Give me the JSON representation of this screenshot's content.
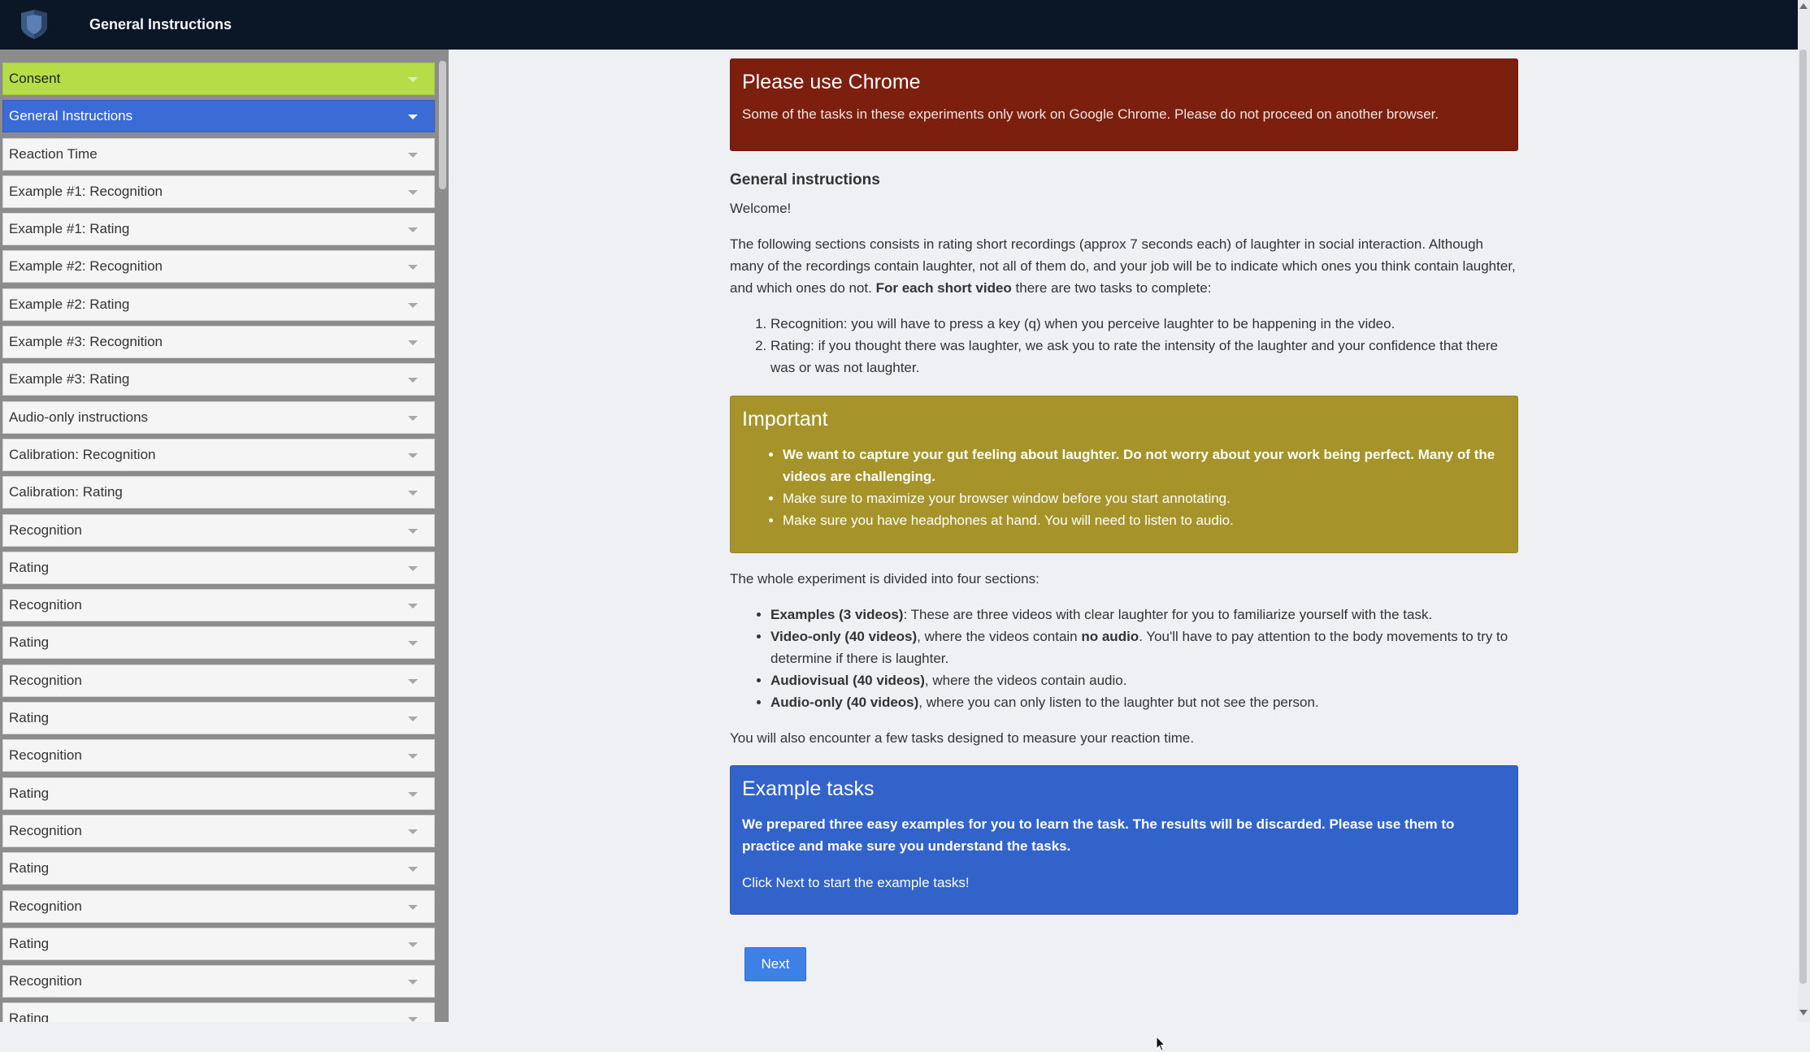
{
  "header": {
    "title": "General Instructions",
    "logo_icon": "shield-icon"
  },
  "sidebar": {
    "items": [
      {
        "label": "Consent"
      },
      {
        "label": "General Instructions"
      },
      {
        "label": "Reaction Time"
      },
      {
        "label": "Example #1: Recognition"
      },
      {
        "label": "Example #1: Rating"
      },
      {
        "label": "Example #2: Recognition"
      },
      {
        "label": "Example #2: Rating"
      },
      {
        "label": "Example #3: Recognition"
      },
      {
        "label": "Example #3: Rating"
      },
      {
        "label": "Audio-only instructions"
      },
      {
        "label": "Calibration: Recognition"
      },
      {
        "label": "Calibration: Rating"
      },
      {
        "label": "Recognition"
      },
      {
        "label": "Rating"
      },
      {
        "label": "Recognition"
      },
      {
        "label": "Rating"
      },
      {
        "label": "Recognition"
      },
      {
        "label": "Rating"
      },
      {
        "label": "Recognition"
      },
      {
        "label": "Rating"
      },
      {
        "label": "Recognition"
      },
      {
        "label": "Rating"
      },
      {
        "label": "Recognition"
      },
      {
        "label": "Rating"
      },
      {
        "label": "Recognition"
      },
      {
        "label": "Rating"
      }
    ]
  },
  "chrome_alert": {
    "title": "Please use Chrome",
    "text": "Some of the tasks in these experiments only work on Google Chrome. Please do not proceed on another browser."
  },
  "instructions": {
    "heading": "General instructions",
    "welcome": "Welcome!",
    "intro": "The following sections consists in rating short recordings (approx 7 seconds each) of laughter in social interaction. Although many of the recordings contain laughter, not all of them do, and your job will be to indicate which ones you think contain laughter, and which ones do not.",
    "intro_bold": "For each short video",
    "intro_tail": " there are two tasks to complete:",
    "tasks": [
      "Recognition: you will have to press a key (q) when you perceive laughter to be happening in the video.",
      "Rating: if you thought there was laughter, we ask you to rate the intensity of the laughter and your confidence that there was or was not laughter."
    ]
  },
  "important": {
    "title": "Important",
    "items": [
      "We want to capture your gut feeling about laughter. Do not worry about your work being perfect. Many of the videos are challenging.",
      "Make sure to maximize your browser window before you start annotating.",
      "Make sure you have headphones at hand. You will need to listen to audio."
    ]
  },
  "sections": {
    "intro": "The whole experiment is divided into four sections:",
    "items": [
      {
        "bold": "Examples (3 videos)",
        "text": ": These are three videos with clear laughter for you to familiarize yourself with the task."
      },
      {
        "bold": "Video-only (40 videos)",
        "text": ", where the videos contain ",
        "bold2": "no audio",
        "text2": ". You'll have to pay attention to the body movements to try to determine if there is laughter."
      },
      {
        "bold": "Audiovisual (40 videos)",
        "text": ", where the videos contain audio."
      },
      {
        "bold": "Audio-only (40 videos)",
        "text": ", where you can only listen to the laughter but not see the person."
      }
    ],
    "outro": "You will also encounter a few tasks designed to measure your reaction time."
  },
  "example_tasks": {
    "title": "Example tasks",
    "bold_text": "We prepared three easy examples for you to learn the task. The results will be discarded. Please use them to practice and make sure you understand the tasks.",
    "text": "Click Next to start the example tasks!"
  },
  "next_label": "Next",
  "colors": {
    "topbar": "#0b1726",
    "consent": "#b5dd48",
    "active": "#3b6cd6",
    "alert_red": "#7d1f0e",
    "alert_gold": "#a6942a",
    "alert_blue": "#3263cb",
    "button": "#3d80e6"
  }
}
